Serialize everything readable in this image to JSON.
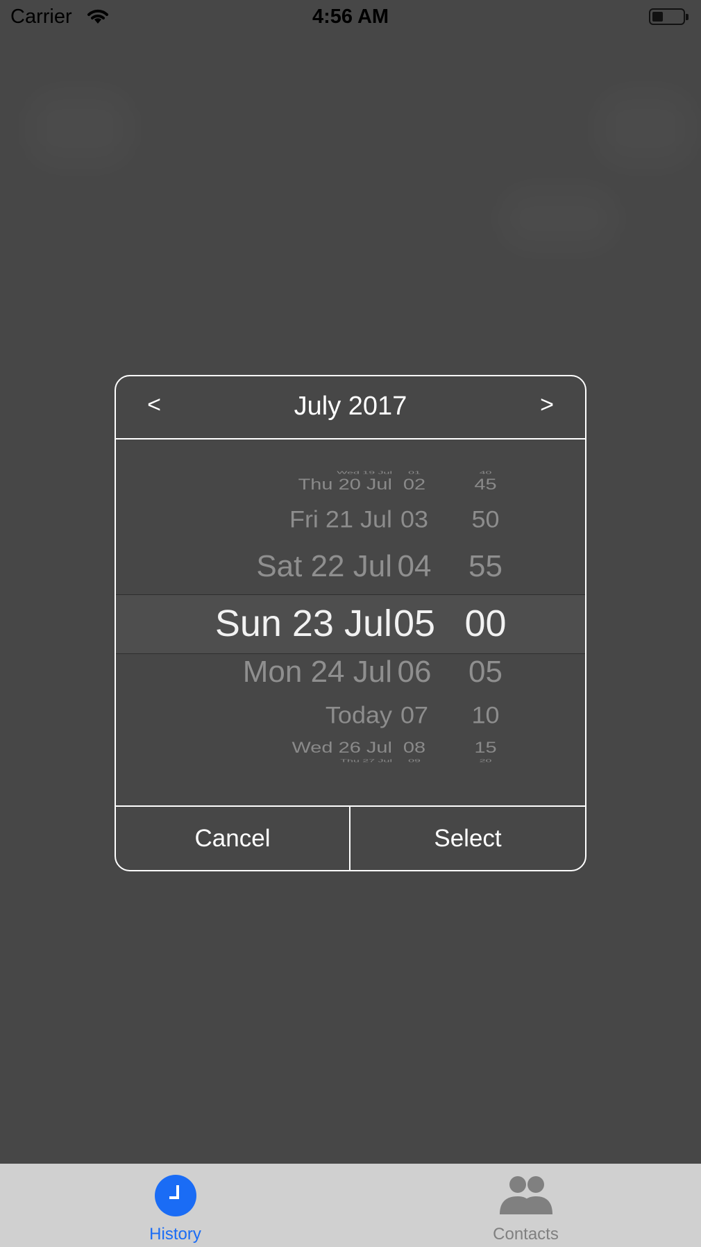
{
  "status_bar": {
    "carrier": "Carrier",
    "time": "4:56 AM",
    "battery_level": 0.35
  },
  "dialog": {
    "prev_label": "<",
    "next_label": ">",
    "month_title": "July 2017",
    "picker_rows": [
      {
        "date": "Wed 19 Jul",
        "hour": "01",
        "minute": "40"
      },
      {
        "date": "Thu 20 Jul",
        "hour": "02",
        "minute": "45"
      },
      {
        "date": "Fri 21 Jul",
        "hour": "03",
        "minute": "50"
      },
      {
        "date": "Sat 22 Jul",
        "hour": "04",
        "minute": "55"
      },
      {
        "date": "Sun 23 Jul",
        "hour": "05",
        "minute": "00"
      },
      {
        "date": "Mon 24 Jul",
        "hour": "06",
        "minute": "05"
      },
      {
        "date": "Today",
        "hour": "07",
        "minute": "10"
      },
      {
        "date": "Wed 26 Jul",
        "hour": "08",
        "minute": "15"
      },
      {
        "date": "Thu 27 Jul",
        "hour": "09",
        "minute": "20"
      }
    ],
    "selected_index": 4,
    "cancel_label": "Cancel",
    "select_label": "Select"
  },
  "tab_bar": {
    "tabs": [
      {
        "label": "History",
        "icon": "clock-icon",
        "active": true,
        "color": "#1a6cf5"
      },
      {
        "label": "Contacts",
        "icon": "contacts-icon",
        "active": false,
        "color": "#808080"
      }
    ]
  }
}
